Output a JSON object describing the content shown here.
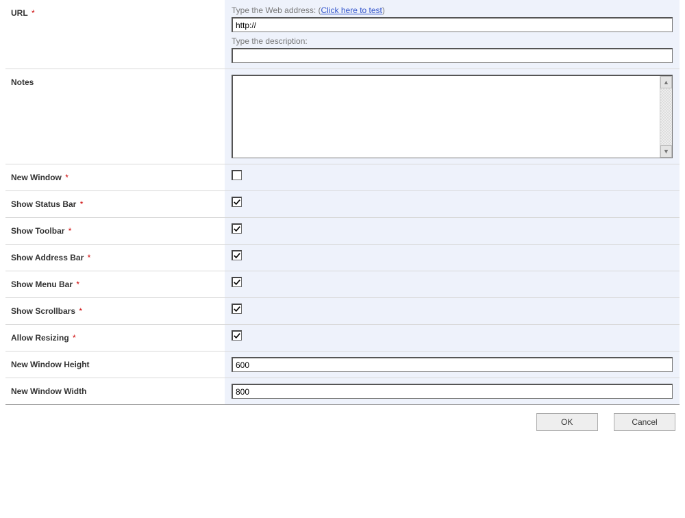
{
  "fields": {
    "url": {
      "label": "URL",
      "required": true,
      "hint_prefix": "Type the Web address: (",
      "hint_link": "Click here to test",
      "hint_suffix": ")",
      "value": "http://",
      "desc_hint": "Type the description:",
      "desc_value": ""
    },
    "notes": {
      "label": "Notes",
      "required": false,
      "value": ""
    },
    "new_window": {
      "label": "New Window",
      "required": true,
      "checked": false
    },
    "show_status_bar": {
      "label": "Show Status Bar",
      "required": true,
      "checked": true
    },
    "show_toolbar": {
      "label": "Show Toolbar",
      "required": true,
      "checked": true
    },
    "show_address_bar": {
      "label": "Show Address Bar",
      "required": true,
      "checked": true
    },
    "show_menu_bar": {
      "label": "Show Menu Bar",
      "required": true,
      "checked": true
    },
    "show_scrollbars": {
      "label": "Show Scrollbars",
      "required": true,
      "checked": true
    },
    "allow_resizing": {
      "label": "Allow Resizing",
      "required": true,
      "checked": true
    },
    "new_window_height": {
      "label": "New Window Height",
      "required": false,
      "value": "600"
    },
    "new_window_width": {
      "label": "New Window Width",
      "required": false,
      "value": "800"
    }
  },
  "buttons": {
    "ok": "OK",
    "cancel": "Cancel"
  },
  "req_marker": "*"
}
